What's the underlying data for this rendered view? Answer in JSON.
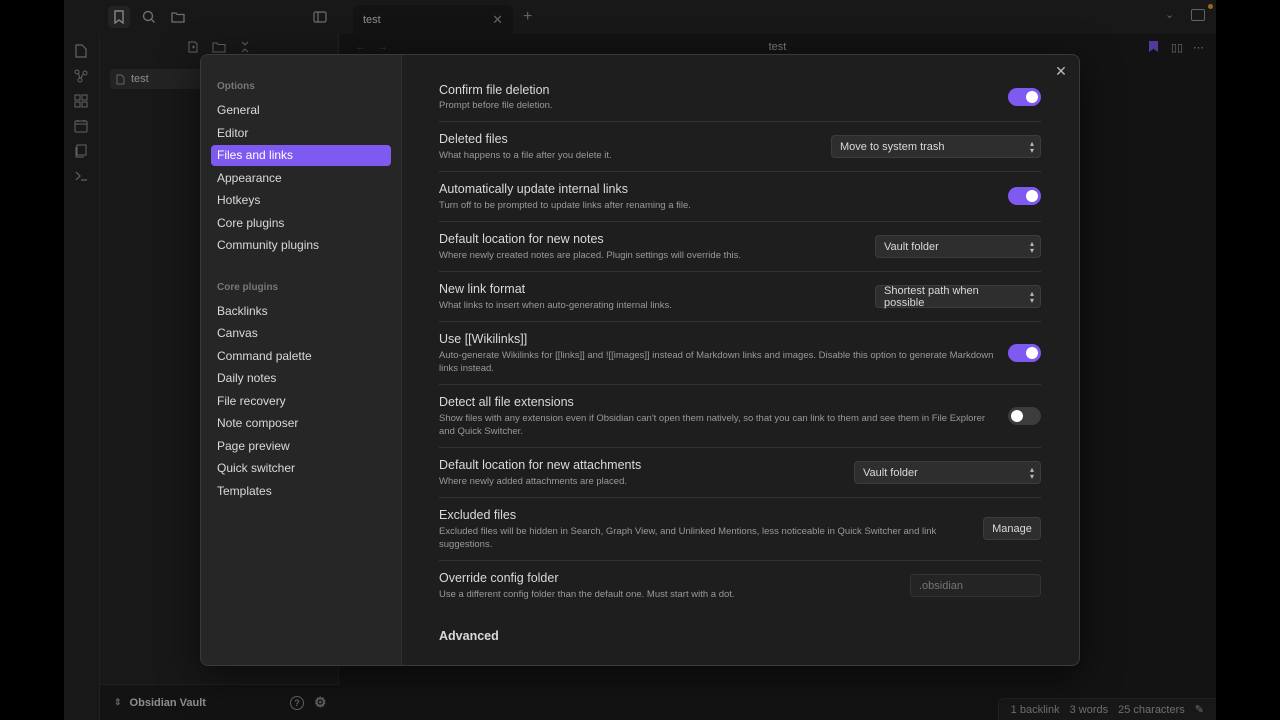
{
  "app": {
    "tab_title": "test",
    "view_title": "test",
    "file_name": "test",
    "vault_name": "Obsidian Vault"
  },
  "status": {
    "backlinks": "1 backlink",
    "words": "3 words",
    "characters": "25 characters"
  },
  "settings": {
    "options_heading": "Options",
    "options": [
      "General",
      "Editor",
      "Files and links",
      "Appearance",
      "Hotkeys",
      "Core plugins",
      "Community plugins"
    ],
    "selected": "Files and links",
    "core_heading": "Core plugins",
    "core_plugins": [
      "Backlinks",
      "Canvas",
      "Command palette",
      "Daily notes",
      "File recovery",
      "Note composer",
      "Page preview",
      "Quick switcher",
      "Templates"
    ],
    "rows": [
      {
        "name": "Confirm file deletion",
        "desc": "Prompt before file deletion.",
        "control": "toggle",
        "on": true
      },
      {
        "name": "Deleted files",
        "desc": "What happens to a file after you delete it.",
        "control": "select",
        "value": "Move to system trash"
      },
      {
        "name": "Automatically update internal links",
        "desc": "Turn off to be prompted to update links after renaming a file.",
        "control": "toggle",
        "on": true
      },
      {
        "name": "Default location for new notes",
        "desc": "Where newly created notes are placed. Plugin settings will override this.",
        "control": "select",
        "value": "Vault folder"
      },
      {
        "name": "New link format",
        "desc": "What links to insert when auto-generating internal links.",
        "control": "select",
        "value": "Shortest path when possible"
      },
      {
        "name": "Use [[Wikilinks]]",
        "desc": "Auto-generate Wikilinks for [[links]] and ![[images]] instead of Markdown links and images. Disable this option to generate Markdown links instead.",
        "control": "toggle",
        "on": true
      },
      {
        "name": "Detect all file extensions",
        "desc": "Show files with any extension even if Obsidian can't open them natively, so that you can link to them and see them in File Explorer and Quick Switcher.",
        "control": "toggle",
        "on": false
      },
      {
        "name": "Default location for new attachments",
        "desc": "Where newly added attachments are placed.",
        "control": "select",
        "value": "Vault folder"
      },
      {
        "name": "Excluded files",
        "desc": "Excluded files will be hidden in Search, Graph View, and Unlinked Mentions, less noticeable in Quick Switcher and link suggestions.",
        "control": "button",
        "value": "Manage"
      },
      {
        "name": "Override config folder",
        "desc": "Use a different config folder than the default one. Must start with a dot.",
        "control": "input",
        "placeholder": ".obsidian"
      }
    ],
    "advanced_heading": "Advanced"
  },
  "colors": {
    "accent": "#7f5af0",
    "background": "#1e1e1e",
    "panel": "#262626"
  }
}
